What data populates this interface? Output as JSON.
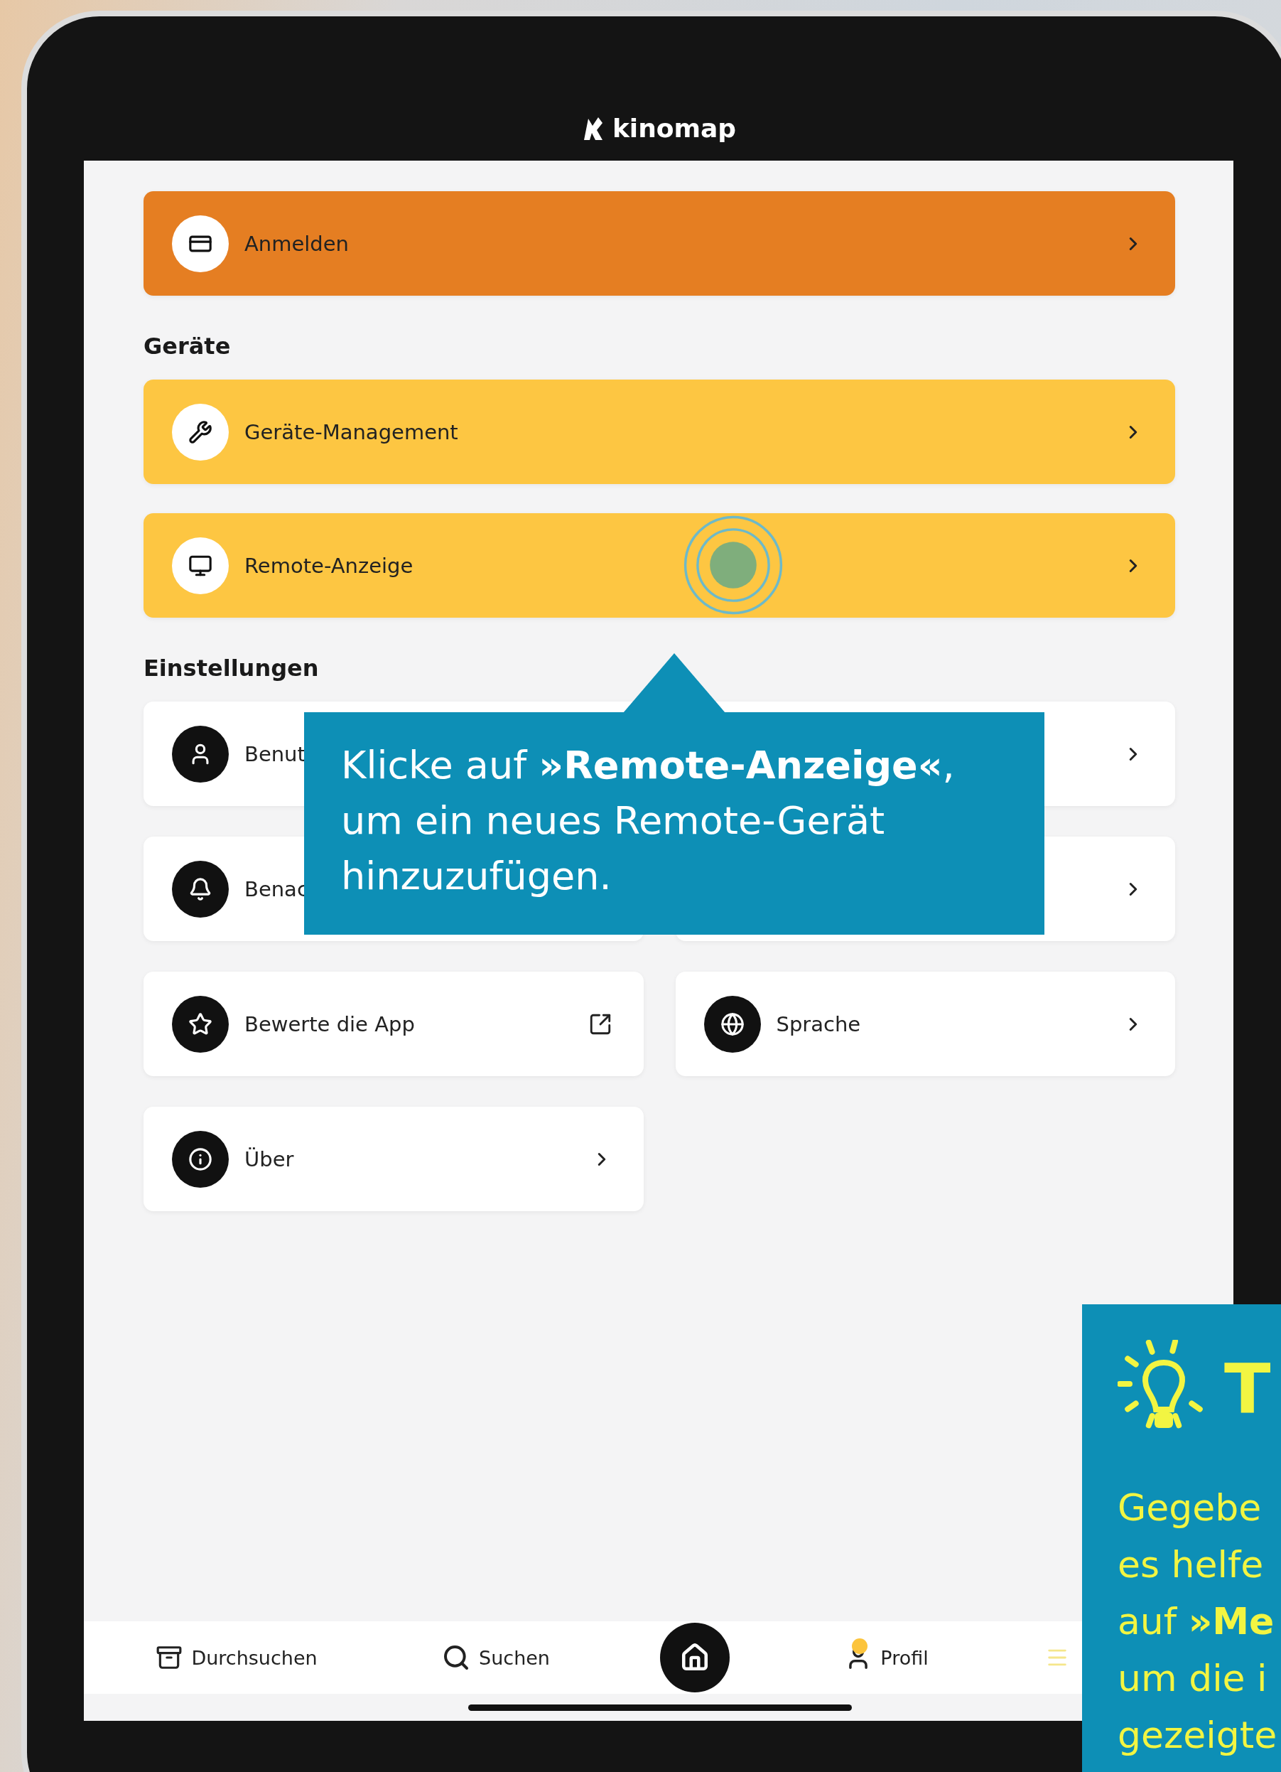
{
  "header": {
    "logo": "kinomap"
  },
  "account": {
    "label": "Anmelden"
  },
  "sections": [
    {
      "title": "Geräte",
      "items": [
        {
          "kind": "link",
          "label": "Geräte-Management",
          "tapped": false
        },
        {
          "kind": "link",
          "label": "Remote-Anzeige",
          "tapped": true
        }
      ]
    },
    {
      "title": "Einstellungen",
      "items": [
        {
          "kind": "link",
          "label": "Benut"
        },
        {
          "kind": "link"
        },
        {
          "kind": "link",
          "label": "Benac"
        },
        {
          "kind": "link"
        },
        {
          "kind": "external",
          "label": "Bewerte die App"
        },
        {
          "kind": "link",
          "label": "Sprache"
        },
        {
          "kind": "link",
          "label": "Über"
        }
      ]
    }
  ],
  "tab_bar": [
    {
      "kind": "tab",
      "label": "Durchsuchen"
    },
    {
      "kind": "tab",
      "label": "Suchen"
    },
    {
      "kind": "home"
    },
    {
      "kind": "tab",
      "label": "Profil",
      "notification_dot": true
    },
    {
      "kind": "tab"
    }
  ],
  "callout": {
    "text": "Klicke auf **»Remote-Anzeige«**, um ein neues Remote-Gerät hinzuzufügen."
  },
  "tip": {
    "title": "T",
    "lines": [
      "Gegebe",
      "es helfe",
      "auf **»Me**",
      "um die i",
      "gezeigte"
    ]
  }
}
